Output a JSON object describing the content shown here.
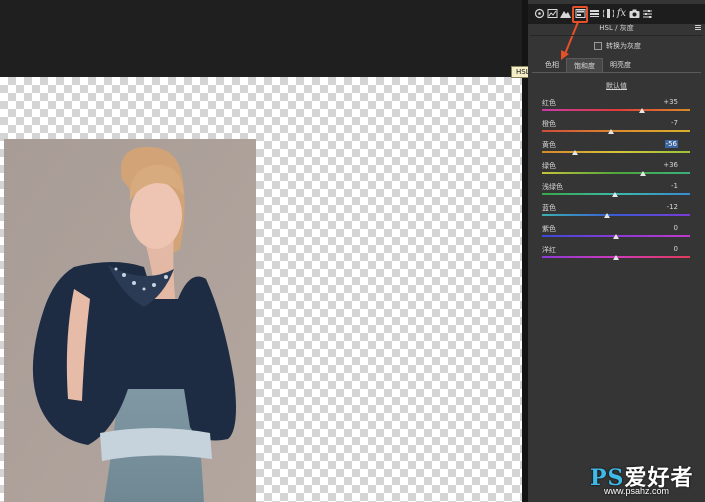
{
  "panel": {
    "title": "HSL / 灰度",
    "convert_gray_label": "转换为灰度",
    "tabs": [
      "色相",
      "饱和度",
      "明亮度"
    ],
    "active_tab": "饱和度",
    "default_link": "默认值",
    "tooltip": "HSL / 灰度",
    "toolbar_icons": [
      "aperture-icon",
      "histogram-icon",
      "mountain-icon",
      "hsl-grayscale-icon",
      "split-toning-icon",
      "lens-icon",
      "fx-icon",
      "camera-icon",
      "presets-icon"
    ]
  },
  "sliders": [
    {
      "label": "红色",
      "value": "+35",
      "fraction": 0.675,
      "selected": false,
      "gradient": [
        "#c83aa8",
        "#e23a3a",
        "#d98a2a"
      ]
    },
    {
      "label": "橙色",
      "value": "-7",
      "fraction": 0.465,
      "selected": false,
      "gradient": [
        "#d04a3a",
        "#dd8a2e",
        "#d9b22a"
      ]
    },
    {
      "label": "黄色",
      "value": "-56",
      "fraction": 0.22,
      "selected": true,
      "gradient": [
        "#d9862a",
        "#d6c43a",
        "#9ac43a"
      ]
    },
    {
      "label": "绿色",
      "value": "+36",
      "fraction": 0.68,
      "selected": false,
      "gradient": [
        "#c8c23a",
        "#4ea83a",
        "#3ab07a"
      ]
    },
    {
      "label": "浅绿色",
      "value": "-1",
      "fraction": 0.495,
      "selected": false,
      "gradient": [
        "#3aa84a",
        "#3abaa8",
        "#3a8ad0"
      ]
    },
    {
      "label": "蓝色",
      "value": "-12",
      "fraction": 0.44,
      "selected": false,
      "gradient": [
        "#3ab0b0",
        "#3a5ad6",
        "#7a3ad6"
      ]
    },
    {
      "label": "紫色",
      "value": "0",
      "fraction": 0.5,
      "selected": false,
      "gradient": [
        "#3a4ad6",
        "#8a3ad6",
        "#c03ac8"
      ]
    },
    {
      "label": "洋红",
      "value": "0",
      "fraction": 0.5,
      "selected": false,
      "gradient": [
        "#8a3ad6",
        "#d03ab8",
        "#e23a5a"
      ]
    }
  ],
  "watermark": {
    "brand_ps": "PS",
    "brand_rest": "爱好者",
    "url": "www.psahz.com"
  }
}
